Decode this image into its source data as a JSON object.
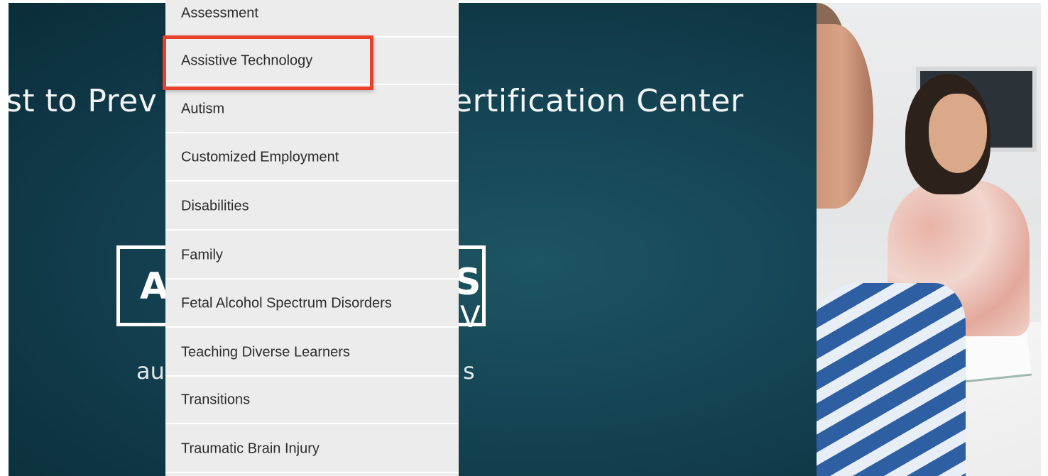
{
  "hero": {
    "title_left": "st to Prev",
    "title_right": "ertification Center",
    "logo_letter_left": "A",
    "logo_letter_right": "S",
    "logo_letter_right_lower": "V",
    "logo_sub_left": "au",
    "logo_sub_right": "s"
  },
  "dropdown": {
    "items": [
      {
        "label": "Assessment"
      },
      {
        "label": "Assistive Technology"
      },
      {
        "label": "Autism"
      },
      {
        "label": "Customized Employment"
      },
      {
        "label": "Disabilities"
      },
      {
        "label": "Family"
      },
      {
        "label": "Fetal Alcohol Spectrum Disorders"
      },
      {
        "label": "Teaching Diverse Learners"
      },
      {
        "label": "Transitions"
      },
      {
        "label": "Traumatic Brain Injury"
      }
    ],
    "highlighted_index": 1
  },
  "colors": {
    "hero_background": "#154554",
    "menu_background": "#ececec",
    "highlight": "#e8402a"
  }
}
